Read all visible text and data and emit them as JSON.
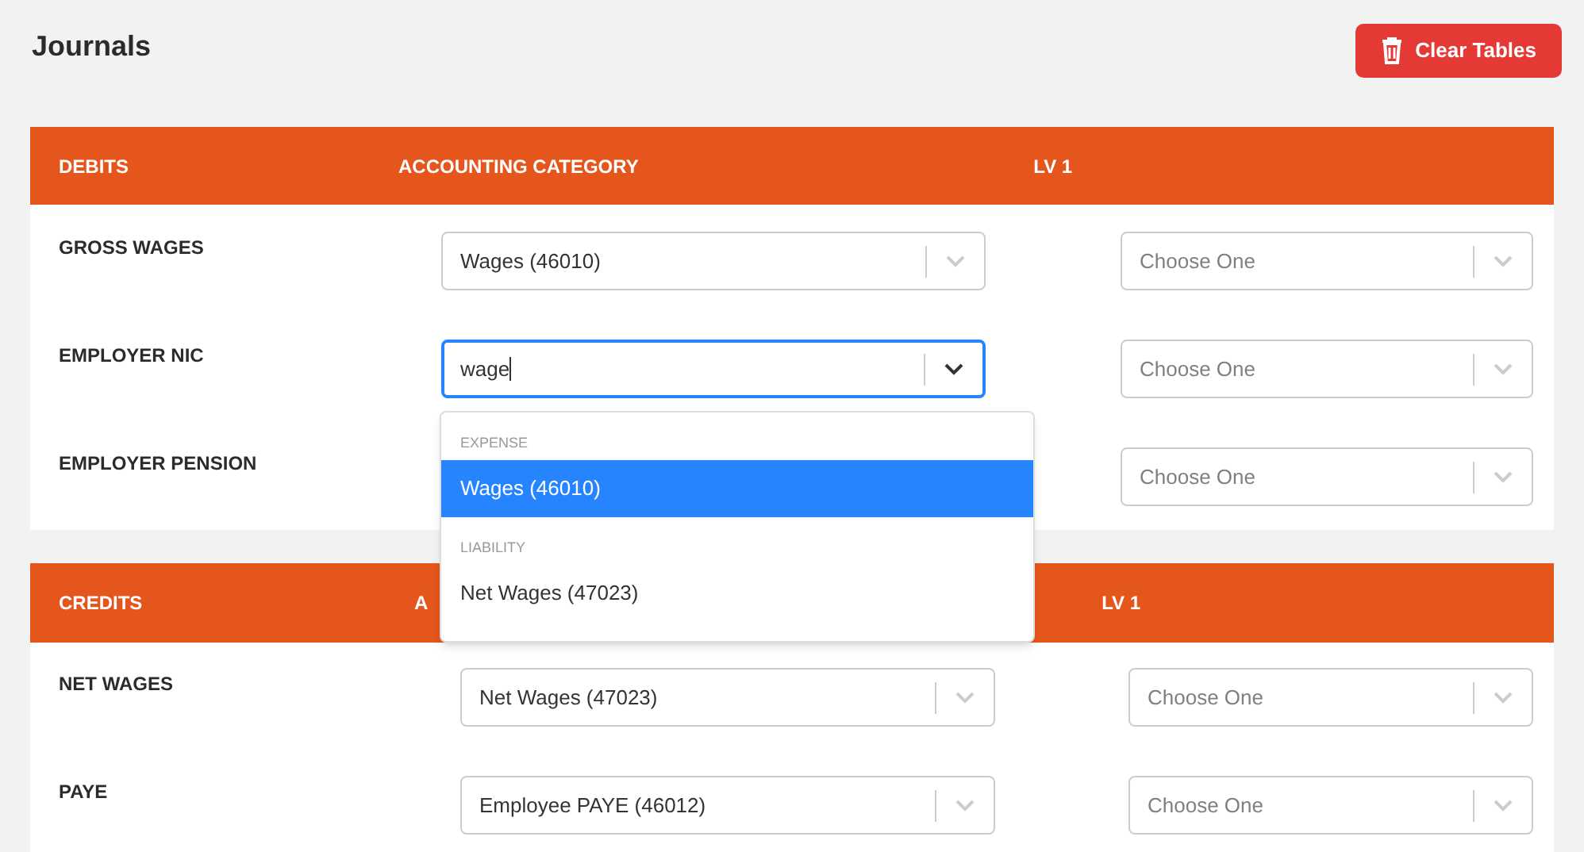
{
  "page": {
    "title": "Journals"
  },
  "clear_button": {
    "label": "Clear Tables"
  },
  "tables": [
    {
      "columns": [
        "DEBITS",
        "ACCOUNTING CATEGORY",
        "LV 1"
      ],
      "rows": [
        {
          "label": "GROSS WAGES",
          "category": {
            "value": "Wages (46010)",
            "focused": false
          },
          "lv1": {
            "placeholder": "Choose One"
          }
        },
        {
          "label": "EMPLOYER NIC",
          "category": {
            "value": "wage",
            "focused": true
          },
          "lv1": {
            "placeholder": "Choose One"
          }
        },
        {
          "label": "EMPLOYER PENSION",
          "lv1": {
            "placeholder": "Choose One"
          }
        }
      ]
    },
    {
      "columns": [
        "CREDITS",
        "A",
        "LV 1"
      ],
      "rows": [
        {
          "label": "NET WAGES",
          "category": {
            "value": "Net Wages (47023)",
            "focused": false
          },
          "lv1": {
            "placeholder": "Choose One"
          }
        },
        {
          "label": "PAYE",
          "category": {
            "value": "Employee PAYE (46012)",
            "focused": false
          },
          "lv1": {
            "placeholder": "Choose One"
          }
        }
      ]
    }
  ],
  "dropdown": {
    "groups": [
      {
        "heading": "EXPENSE",
        "options": [
          {
            "label": "Wages (46010)",
            "selected": true
          }
        ]
      },
      {
        "heading": "LIABILITY",
        "options": [
          {
            "label": "Net Wages (47023)",
            "selected": false
          }
        ]
      }
    ]
  }
}
